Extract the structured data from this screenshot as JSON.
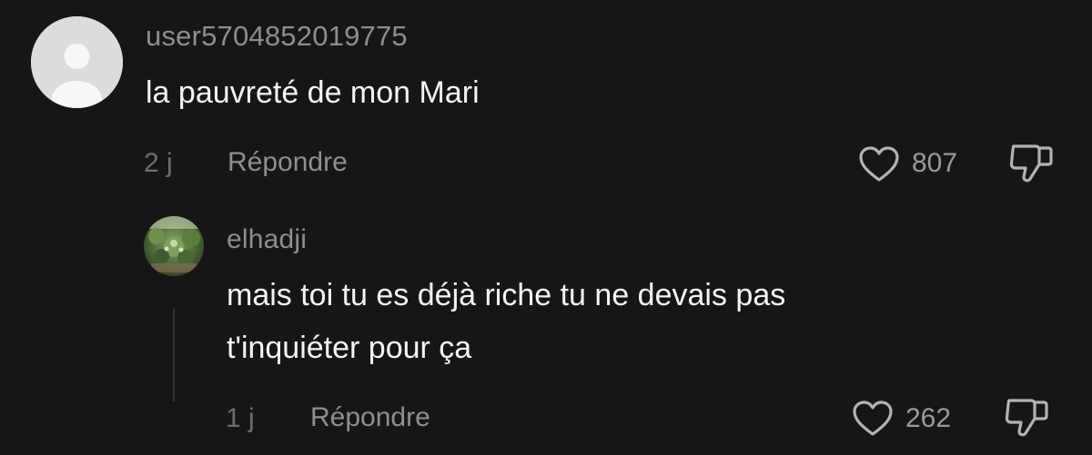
{
  "comment": {
    "username": "user5704852019775",
    "text": "la pauvreté de mon Mari",
    "time": "2 j",
    "reply_label": "Répondre",
    "likes": "807",
    "avatar_icon": "default-user-avatar-icon",
    "like_icon": "heart-outline-icon",
    "dislike_icon": "thumbs-down-icon"
  },
  "reply": {
    "username": "elhadji",
    "text_lines": [
      "mais toi tu es déjà riche tu ne devais pas",
      "t'inquiéter pour ça"
    ],
    "time": "1 j",
    "reply_label": "Répondre",
    "likes": "262",
    "avatar_icon": "garden-photo-avatar",
    "like_icon": "heart-outline-icon",
    "dislike_icon": "thumbs-down-icon"
  },
  "colors": {
    "background": "#161616",
    "text_primary": "#f4f4f4",
    "text_secondary": "#8e8e8e",
    "text_muted": "#6e6e6e"
  }
}
